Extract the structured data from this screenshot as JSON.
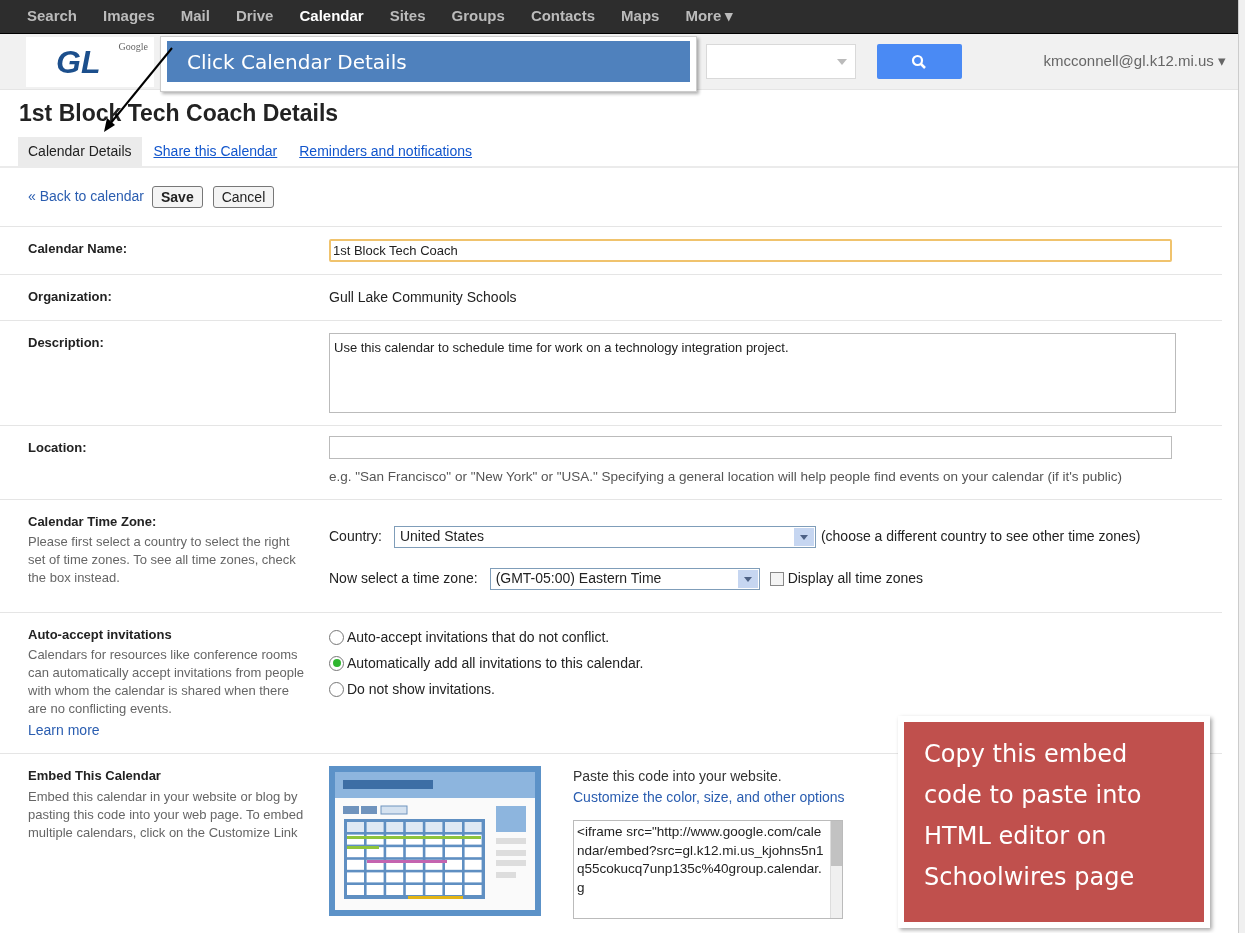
{
  "nav": [
    {
      "label": "Search",
      "selected": false
    },
    {
      "label": "Images",
      "selected": false
    },
    {
      "label": "Mail",
      "selected": false
    },
    {
      "label": "Drive",
      "selected": false
    },
    {
      "label": "Calendar",
      "selected": true
    },
    {
      "label": "Sites",
      "selected": false
    },
    {
      "label": "Groups",
      "selected": false
    },
    {
      "label": "Contacts",
      "selected": false
    },
    {
      "label": "Maps",
      "selected": false
    },
    {
      "label": "More ▾",
      "selected": false
    }
  ],
  "logo": {
    "brand": "Google",
    "initials": "GL"
  },
  "account": "kmcconnell@gl.k12.mi.us ▾",
  "title": "1st Block Tech Coach Details",
  "tabs": [
    {
      "label": "Calendar Details",
      "selected": true
    },
    {
      "label": "Share this Calendar",
      "selected": false
    },
    {
      "label": "Reminders and notifications",
      "selected": false
    }
  ],
  "actions": {
    "back": "« Back to calendar",
    "save": "Save",
    "cancel": "Cancel"
  },
  "calendar_name": {
    "label": "Calendar Name:",
    "value": "1st Block Tech Coach"
  },
  "organization": {
    "label": "Organization:",
    "value": "Gull Lake Community Schools"
  },
  "description": {
    "label": "Description:",
    "value": "Use this calendar to schedule time for work on a technology integration project."
  },
  "location": {
    "label": "Location:",
    "hint": "e.g. \"San Francisco\" or \"New York\" or \"USA.\" Specifying a general location will help people find events on your calendar (if it's public)"
  },
  "time_zone": {
    "label": "Calendar Time Zone:",
    "help": "Please first select a country to select the right set of time zones. To see all time zones, check the box instead.",
    "country_label": "Country:",
    "country": "United States",
    "country_note": "(choose a different country to see other time zones)",
    "zone_label": "Now select a time zone:",
    "zone": "(GMT-05:00) Eastern Time",
    "show_all": {
      "label": "Display all time zones",
      "checked": false
    }
  },
  "auto_accept": {
    "label": "Auto-accept invitations",
    "help": "Calendars for resources like conference rooms can automatically accept invitations from people with whom the calendar is shared when there are no conflicting events.",
    "learn_more": "Learn more",
    "options": [
      {
        "label": "Auto-accept invitations that do not conflict.",
        "selected": false
      },
      {
        "label": "Automatically add all invitations to this calendar.",
        "selected": true
      },
      {
        "label": "Do not show invitations.",
        "selected": false
      }
    ]
  },
  "embed": {
    "label": "Embed This Calendar",
    "help": "Embed this calendar in your website or blog by pasting this code into your web page. To embed multiple calendars, click on the Customize Link",
    "paste_note": "Paste this code into your website.",
    "customize_link": "Customize the color, size, and other options",
    "code": "<iframe src=\"http://www.google.com/calendar/embed?src=gl.k12.mi.us_kjohns5n1q55cokucq7unp135c%40group.calendar.g"
  },
  "callouts": [
    {
      "text": "Click Calendar Details",
      "color": "#4f81bd"
    },
    {
      "text": "Copy this embed code to paste into HTML editor on Schoolwires page",
      "color": "#c0504d"
    }
  ]
}
